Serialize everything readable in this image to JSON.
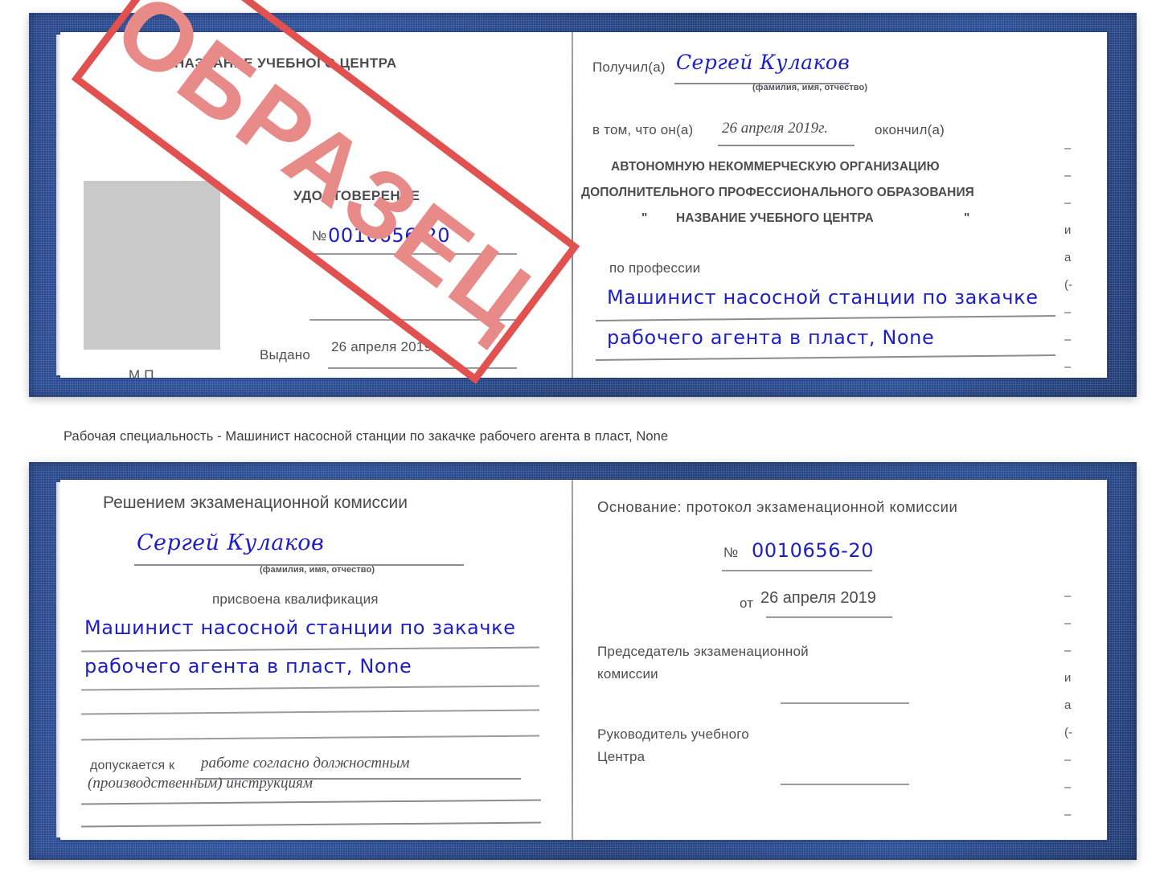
{
  "colors": {
    "cover_blue": "#28478c",
    "handwriting_blue": "#1d1ec9",
    "stamp_red": "#e0514f",
    "stamp_fill": "#e88b88",
    "photo_gray": "#c9c9c9",
    "text_gray": "#4a4a4f"
  },
  "stamp": {
    "text": "ОБРАЗЕЦ"
  },
  "certificate_top": {
    "left_page": {
      "header": "НАЗВАНИЕ УЧЕБНОГО ЦЕНТРА",
      "doc_type": "УДОСТОВЕРЕНИЕ",
      "number_label": "№",
      "number_value": "0010656-20",
      "issued_label": "Выдано",
      "issued_date": "26 апреля 2019",
      "seal_label": "М.П."
    },
    "right_page": {
      "received_label": "Получил(а)",
      "received_name": "Сергей Кулаков",
      "name_hint": "(фамилия, имя, отчество)",
      "in_that_label": "в том, что он(а)",
      "completion_date": "26 апреля 2019г.",
      "finished_label": "окончил(а)",
      "org_line1": "АВТОНОМНУЮ НЕКОММЕРЧЕСКУЮ ОРГАНИЗАЦИЮ",
      "org_line2": "ДОПОЛНИТЕЛЬНОГО ПРОФЕССИОНАЛЬНОГО ОБРАЗОВАНИЯ",
      "org_quote_open": "\"",
      "org_line3": "НАЗВАНИЕ УЧЕБНОГО ЦЕНТРА",
      "org_quote_close": "\"",
      "profession_label": "по профессии",
      "profession_line1": "Машинист насосной станции по закачке",
      "profession_line2": "рабочего агента в пласт, None"
    }
  },
  "caption": {
    "text": "Рабочая специальность - Машинист насосной станции по закачке рабочего агента в пласт, None"
  },
  "certificate_bottom": {
    "left_page": {
      "header": "Решением экзаменационной комиссии",
      "name": "Сергей Кулаков",
      "name_hint": "(фамилия, имя, отчество)",
      "qualification_label": "присвоена квалификация",
      "qualification_line1": "Машинист насосной станции по закачке",
      "qualification_line2": "рабочего агента в пласт, None",
      "admitted_label": "допускается к",
      "admitted_value_line1": "работе согласно должностным",
      "admitted_value_line2": "(производственным) инструкциям"
    },
    "right_page": {
      "basis_label": "Основание: протокол экзаменационной комиссии",
      "number_label": "№",
      "number_value": "0010656-20",
      "date_label": "от",
      "date_value": "26 апреля 2019",
      "chair_line1": "Председатель экзаменационной",
      "chair_line2": "комиссии",
      "head_line1": "Руководитель учебного",
      "head_line2": "Центра"
    }
  },
  "margin_fragments_top": [
    "–",
    "–",
    "–",
    "и",
    "а",
    "(-",
    "–",
    "–",
    "–",
    "–"
  ],
  "margin_fragments_bottom": [
    "–",
    "–",
    "–",
    "и",
    "а",
    "(-",
    "–",
    "–",
    "–",
    "–"
  ]
}
